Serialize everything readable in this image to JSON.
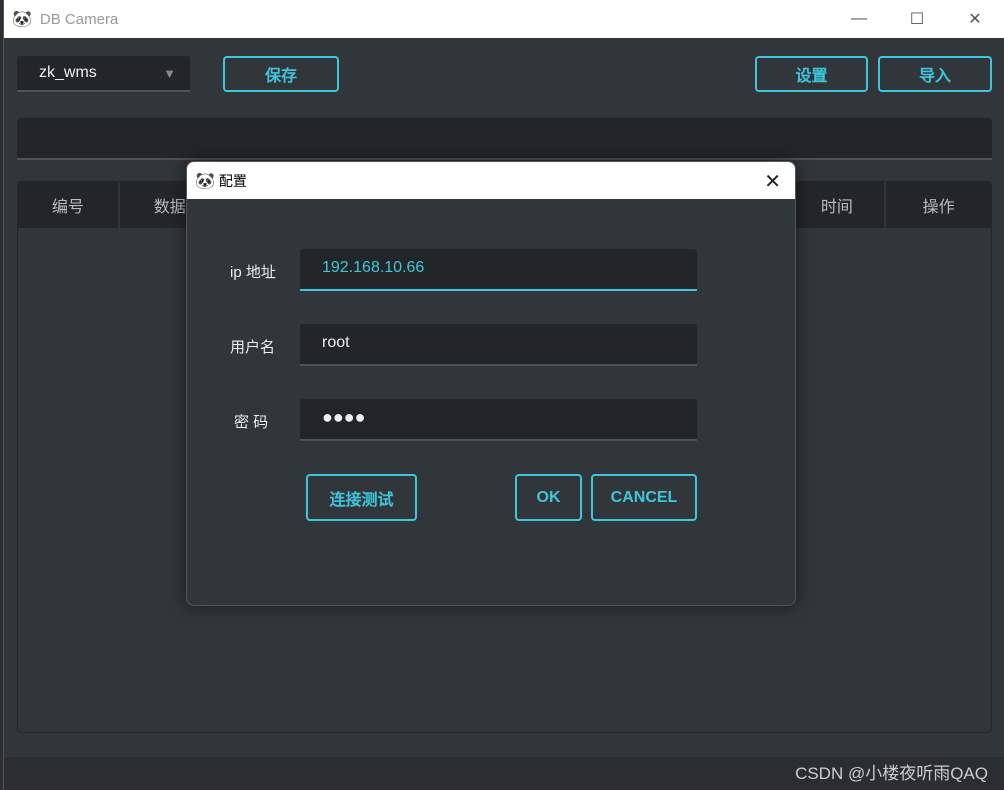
{
  "window": {
    "title": "DB Camera",
    "panda_icon": "🐼",
    "minimize": "—",
    "maximize": "☐",
    "close": "✕"
  },
  "toolbar": {
    "db_select": "zk_wms",
    "save": "保存",
    "settings": "设置",
    "import": "导入"
  },
  "table": {
    "columns": [
      "编号",
      "数据",
      "时间",
      "操作"
    ]
  },
  "watermark": "CSDN @小楼夜听雨QAQ",
  "dialog": {
    "title": "配置",
    "close": "✕",
    "fields": [
      {
        "label": "ip 地址",
        "value": "192.168.10.66"
      },
      {
        "label": "用户名",
        "value": "root"
      },
      {
        "label": "密 码",
        "value": "●●●●"
      }
    ],
    "test_button": "连接测试",
    "ok_button": "OK",
    "cancel_button": "CANCEL"
  },
  "colors": {
    "accent": "#3fc6dc",
    "background": "#31363b",
    "input": "#232629"
  }
}
